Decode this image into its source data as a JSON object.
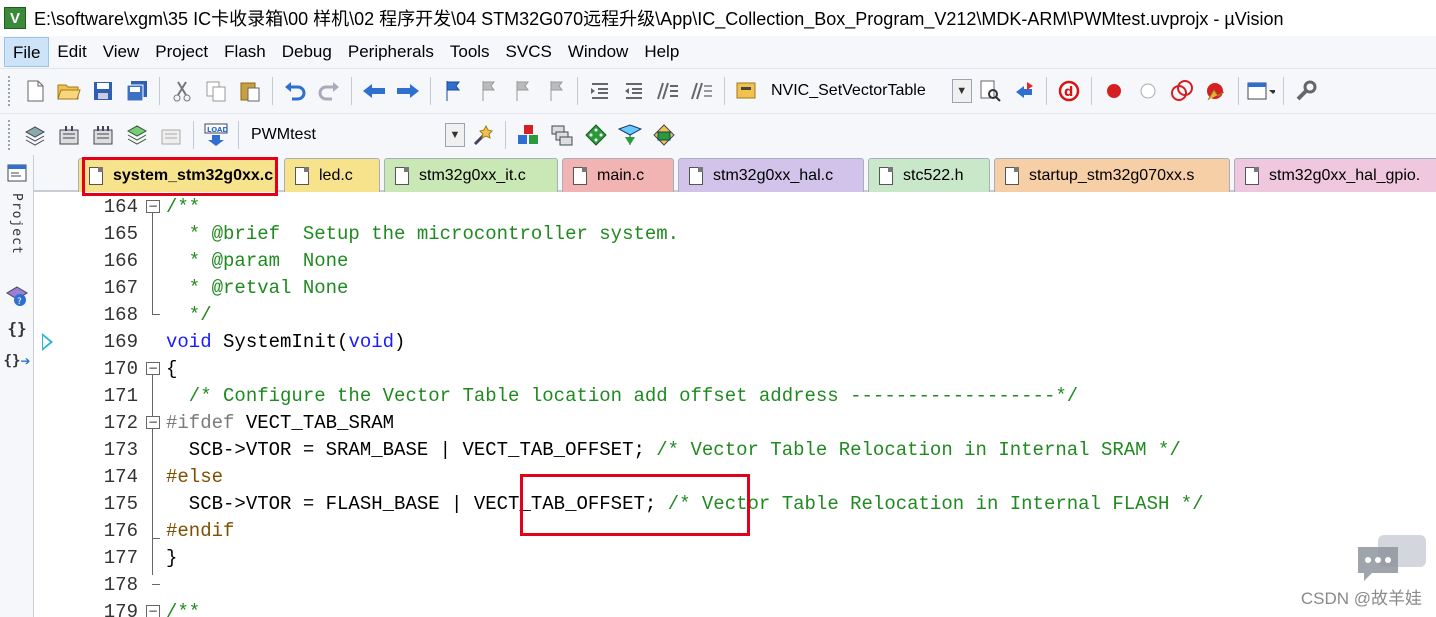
{
  "window": {
    "app_icon": "V",
    "title": "E:\\software\\xgm\\35 IC卡收录箱\\00 样机\\02 程序开发\\04 STM32G070远程升级\\App\\IC_Collection_Box_Program_V212\\MDK-ARM\\PWMtest.uvprojx - µVision"
  },
  "menu": [
    {
      "label": "File"
    },
    {
      "label": "Edit"
    },
    {
      "label": "View"
    },
    {
      "label": "Project"
    },
    {
      "label": "Flash"
    },
    {
      "label": "Debug"
    },
    {
      "label": "Peripherals"
    },
    {
      "label": "Tools"
    },
    {
      "label": "SVCS"
    },
    {
      "label": "Window"
    },
    {
      "label": "Help"
    }
  ],
  "toolbar1": {
    "function_combo_value": "NVIC_SetVectorTable",
    "icons": [
      "new-file-icon",
      "open-file-icon",
      "save-icon",
      "save-all-icon",
      "cut-icon",
      "copy-icon",
      "paste-icon",
      "undo-icon",
      "redo-icon",
      "nav-back-icon",
      "nav-forward-icon",
      "bookmark-set-icon",
      "bookmark-prev-icon",
      "bookmark-next-icon",
      "bookmark-clear-icon",
      "indent-icon",
      "unindent-icon",
      "comment-icon",
      "uncomment-icon",
      "find-in-files-icon",
      "find-icon",
      "incremental-find-icon",
      "debug-session-icon",
      "breakpoint-insert-icon",
      "breakpoint-disable-icon",
      "breakpoint-disable-all-icon",
      "breakpoint-kill-all-icon",
      "window-layout-icon",
      "configure-icon"
    ]
  },
  "toolbar2": {
    "target_combo_value": "PWMtest",
    "load_label": "LOAD",
    "icons": [
      "translate-icon",
      "build-icon",
      "rebuild-icon",
      "batch-build-icon",
      "stop-build-icon",
      "download-icon",
      "target-options-icon",
      "manage-components-icon",
      "file-extensions-icon",
      "select-packs-icon",
      "pack-installer-icon",
      "event-recorder-icon"
    ]
  },
  "leftpanel": {
    "project_label": "Project",
    "icons": [
      "project-window-icon",
      "books-icon",
      "functions-icon",
      "templates-icon"
    ],
    "functions_glyph": "{}",
    "templates_glyph": "{}"
  },
  "tabs": [
    {
      "label": "system_stm32g0xx.c",
      "color": "#f7e38b",
      "active": true
    },
    {
      "label": "led.c",
      "color": "#f7e38b",
      "active": false
    },
    {
      "label": "stm32g0xx_it.c",
      "color": "#c9e8b5",
      "active": false
    },
    {
      "label": "main.c",
      "color": "#f2b3b3",
      "active": false
    },
    {
      "label": "stm32g0xx_hal.c",
      "color": "#d2c3ea",
      "active": false
    },
    {
      "label": "stc522.h",
      "color": "#c9e8c9",
      "active": false
    },
    {
      "label": "startup_stm32g070xx.s",
      "color": "#f7cfa6",
      "active": false
    },
    {
      "label": "stm32g0xx_hal_gpio.",
      "color": "#efc8e0",
      "active": false
    }
  ],
  "code": {
    "lines": [
      {
        "n": "164",
        "parts": [
          {
            "t": "/**",
            "c": "cmt"
          }
        ]
      },
      {
        "n": "165",
        "parts": [
          {
            "t": "  * @brief  Setup the microcontroller system.",
            "c": "cmt"
          }
        ]
      },
      {
        "n": "166",
        "parts": [
          {
            "t": "  * @param  None",
            "c": "cmt"
          }
        ]
      },
      {
        "n": "167",
        "parts": [
          {
            "t": "  * @retval None",
            "c": "cmt"
          }
        ]
      },
      {
        "n": "168",
        "parts": [
          {
            "t": "  */",
            "c": "cmt"
          }
        ]
      },
      {
        "n": "169",
        "parts": [
          {
            "t": "void",
            "c": "kw"
          },
          {
            "t": " SystemInit(",
            "c": ""
          },
          {
            "t": "void",
            "c": "kw"
          },
          {
            "t": ")",
            "c": ""
          }
        ]
      },
      {
        "n": "170",
        "parts": [
          {
            "t": "{",
            "c": ""
          }
        ]
      },
      {
        "n": "171",
        "parts": [
          {
            "t": "  /* Configure the Vector Table location add offset address ------------------*/",
            "c": "cmt"
          }
        ]
      },
      {
        "n": "172",
        "parts": [
          {
            "t": "#ifdef",
            "c": "pp2"
          },
          {
            "t": " VECT_TAB_SRAM",
            "c": ""
          }
        ]
      },
      {
        "n": "173",
        "parts": [
          {
            "t": "  SCB->VTOR = SRAM_BASE | VECT_TAB_OFFSET; ",
            "c": ""
          },
          {
            "t": "/* Vector Table Relocation in Internal SRAM */",
            "c": "cmt"
          }
        ]
      },
      {
        "n": "174",
        "parts": [
          {
            "t": "#else",
            "c": "pp"
          }
        ]
      },
      {
        "n": "175",
        "parts": [
          {
            "t": "  SCB->VTOR = FLASH_BASE | VECT_TAB_OFFSET; ",
            "c": ""
          },
          {
            "t": "/* Vector Table Relocation in Internal FLASH */",
            "c": "cmt"
          }
        ]
      },
      {
        "n": "176",
        "parts": [
          {
            "t": "#endif",
            "c": "pp"
          }
        ]
      },
      {
        "n": "177",
        "parts": [
          {
            "t": "}",
            "c": ""
          }
        ]
      },
      {
        "n": "178",
        "parts": [
          {
            "t": "",
            "c": ""
          }
        ]
      },
      {
        "n": "179",
        "parts": [
          {
            "t": "/**",
            "c": "cmt"
          }
        ]
      }
    ]
  },
  "watermark": "CSDN @故羊娃"
}
